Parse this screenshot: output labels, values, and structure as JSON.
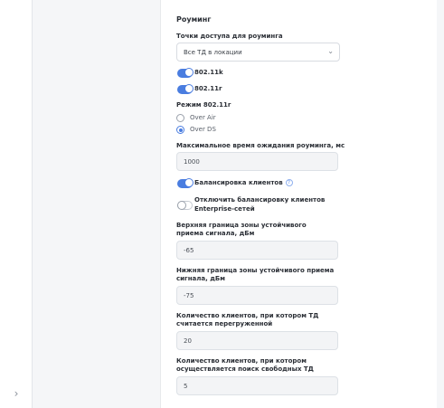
{
  "left_panel": {
    "expand_icon": "chevron-right-icon",
    "expand_glyph": "›"
  },
  "roaming": {
    "section_title": "Роуминг",
    "access_points_label": "Точки доступа для роуминга",
    "access_points_select": {
      "value": "Все ТД в локации",
      "chevron": "⌄"
    },
    "toggle_80211k": {
      "label": "802.11k",
      "on": true
    },
    "toggle_80211r": {
      "label": "802.11r",
      "on": true
    },
    "mode_label": "Режим 802.11r",
    "mode_options": [
      {
        "label": "Over Air",
        "checked": false
      },
      {
        "label": "Over DS",
        "checked": true
      }
    ],
    "max_wait_label": "Максимальное время ожидания роуминга, мс",
    "max_wait_value": "1000",
    "client_balancing": {
      "label": "Балансировка клиентов",
      "on": true,
      "info_glyph": "?"
    },
    "disable_enterprise_balancing": {
      "label": "Отключить балансировку клиентов Enterprise-сетей",
      "on": false
    },
    "upper_bound_label": "Верхняя граница зоны устойчивого приема сигнала, дБм",
    "upper_bound_value": "-65",
    "lower_bound_label": "Нижняя граница зоны устойчивого приема сигнала, дБм",
    "lower_bound_value": "-75",
    "overload_label": "Количество клиентов, при котором ТД считается перегруженной",
    "overload_value": "20",
    "search_label": "Количество клиентов, при котором осуществляется поиск свободных ТД",
    "search_value": "5"
  },
  "colors": {
    "accent": "#4a7de0",
    "background": "#f5f6f8",
    "input_bg": "#f3f4f6"
  }
}
